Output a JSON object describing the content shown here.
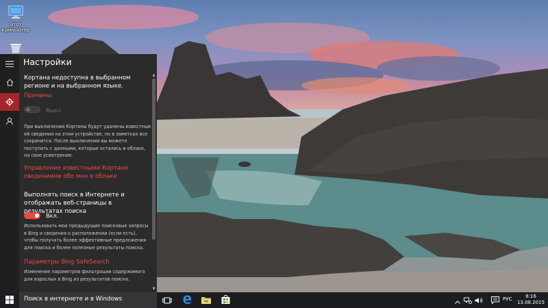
{
  "desktop": {
    "icons": [
      {
        "label_line1": "Этот",
        "label_line2": "компьютер",
        "icon": "computer-icon"
      },
      {
        "icon": "recycle-bin-icon"
      }
    ]
  },
  "settings": {
    "title": "Настройки",
    "rail": {
      "items": [
        {
          "icon": "hamburger-menu-icon"
        },
        {
          "icon": "home-icon"
        },
        {
          "icon": "gear-icon",
          "active": true
        },
        {
          "icon": "feedback-icon"
        }
      ]
    },
    "cortana_unavailable": "Кортана недоступна в выбранном регионе и на выбранном языке.",
    "reasons_link": "Причины",
    "cortana_toggle_label": "Выкл.",
    "cortana_off_description": "При выключении Кортаны будут удалены известные ей сведения на этом устройстве, но в заметках все сохранится. После выключения вы можете поступать с данными, которые остались в облаке, на свое усмотрение.",
    "manage_info_link": "Управление известными Кортане сведениями обо мне в облаке",
    "search_online_heading": "Выполнять поиск в Интернете и отображать веб-страницы в результатах поиска",
    "search_online_toggle_label": "Вкл.",
    "search_online_description": "Использовать мои предыдущие поисковые запросы в Bing и сведения о расположении (если есть), чтобы получать более эффективные предложения для поиска и более полезные результаты поиска.",
    "safesearch_link": "Параметры Bing SafeSearch",
    "safesearch_description": "Изменение параметров фильтрации содержимого для взрослых в Bing из результатов поиска."
  },
  "taskbar": {
    "start_icon": "windows-logo-icon",
    "search_placeholder": "Поиск в интернете и в Windows",
    "pinned": [
      {
        "icon": "task-view-icon"
      },
      {
        "icon": "edge-icon"
      },
      {
        "icon": "file-explorer-icon"
      },
      {
        "icon": "store-icon"
      }
    ],
    "tray": {
      "icons": [
        "show-hidden-icon",
        "network-icon",
        "volume-icon",
        "notifications-icon"
      ],
      "language": "РУС",
      "time": "8:16",
      "date": "13.08.2015"
    }
  },
  "colors": {
    "accent": "#e84b40",
    "rail_active": "#a4262c",
    "panel_bg": "#2b2b2b",
    "taskbar_bg": "#1b1d22",
    "search_bg": "#353638"
  }
}
